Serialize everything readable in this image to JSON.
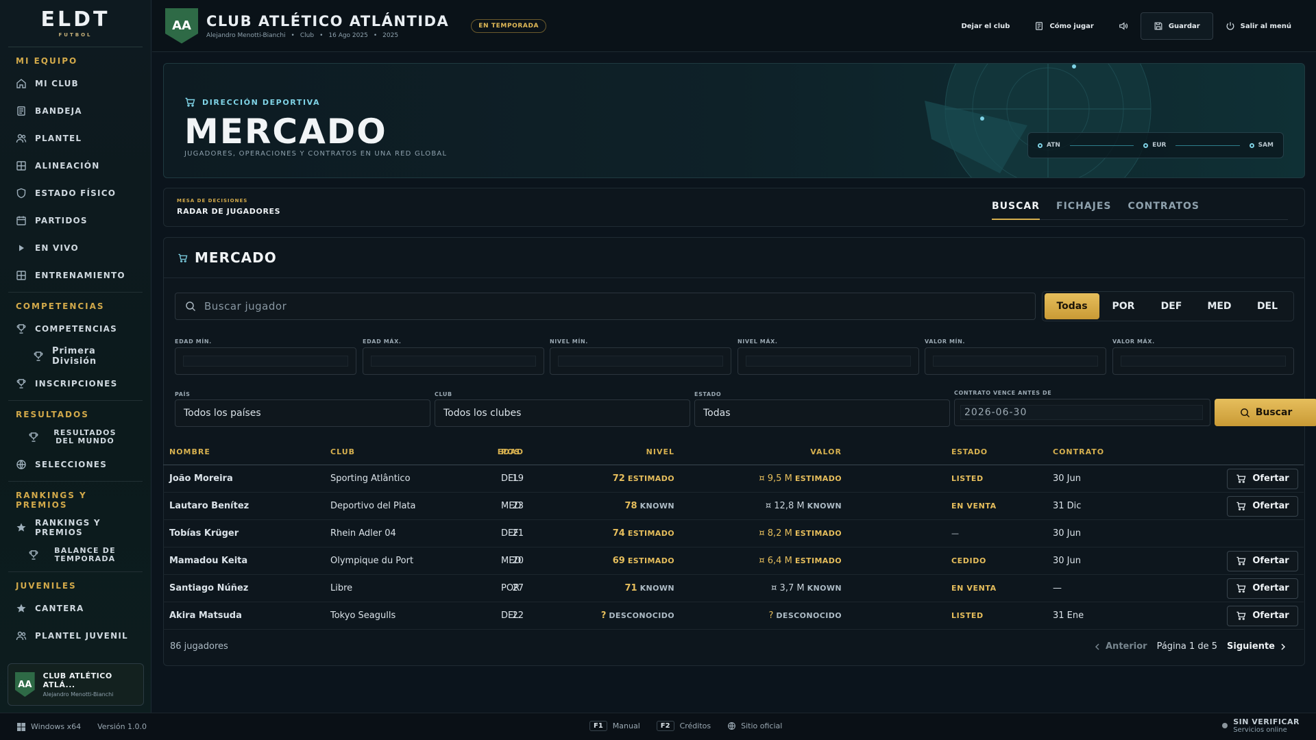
{
  "app": {
    "logo": "ELDT",
    "logo_sub": "FUTBOL"
  },
  "sidebar": {
    "sections": [
      {
        "title": "MI EQUIPO",
        "items": [
          {
            "label": "MI CLUB",
            "icon": "home-icon"
          },
          {
            "label": "BANDEJA",
            "icon": "inbox-icon"
          },
          {
            "label": "PLANTEL",
            "icon": "users-icon"
          },
          {
            "label": "ALINEACIÓN",
            "icon": "formation-icon"
          },
          {
            "label": "ESTADO FÍSICO",
            "icon": "shield-icon"
          },
          {
            "label": "PARTIDOS",
            "icon": "calendar-icon"
          },
          {
            "label": "EN VIVO",
            "icon": "play-icon"
          },
          {
            "label": "ENTRENAMIENTO",
            "icon": "training-icon"
          }
        ]
      },
      {
        "title": "COMPETENCIAS",
        "items": [
          {
            "label": "COMPETENCIAS",
            "icon": "trophy-icon"
          },
          {
            "label": "Primera División",
            "icon": "trophy-icon"
          },
          {
            "label": "INSCRIPCIONES",
            "icon": "trophy-icon"
          }
        ]
      },
      {
        "title": "RESULTADOS",
        "items": [
          {
            "label": "RESULTADOS DEL MUNDO",
            "icon": "trophy-icon"
          },
          {
            "label": "SELECCIONES",
            "icon": "globe-icon"
          }
        ]
      },
      {
        "title": "RANKINGS Y PREMIOS",
        "items": [
          {
            "label": "RANKINGS Y PREMIOS",
            "icon": "star-icon"
          },
          {
            "label": "BALANCE DE TEMPORADA",
            "icon": "trophy-icon"
          }
        ]
      },
      {
        "title": "JUVENILES",
        "items": [
          {
            "label": "CANTERA",
            "icon": "star-icon"
          },
          {
            "label": "PLANTEL JUVENIL",
            "icon": "users-icon"
          }
        ]
      }
    ],
    "club_card": {
      "badge": "AA",
      "name": "CLUB ATLÉTICO ATLÁ...",
      "manager": "Alejandro Menotti-Bianchi"
    }
  },
  "topbar": {
    "badge": "AA",
    "club_name": "CLUB ATLÉTICO ATLÁNTIDA",
    "meta": [
      "Alejandro Menotti-Bianchi",
      "•",
      "Club",
      "•",
      "16 Ago 2025",
      "•",
      "2025"
    ],
    "season_status": "EN TEMPORADA",
    "actions": {
      "leave": "Dejar el club",
      "how_to": "Cómo jugar",
      "save": "Guardar",
      "exit": "Salir al menú"
    }
  },
  "hero": {
    "kicker": "DIRECCIÓN DEPORTIVA",
    "title": "MERCADO",
    "subtitle": "JUGADORES, OPERACIONES Y CONTRATOS EN UNA RED GLOBAL",
    "route": [
      "ATN",
      "EUR",
      "SAM"
    ]
  },
  "subnav": {
    "kicker": "MESA DE DECISIONES",
    "title": "RADAR DE JUGADORES",
    "tabs": [
      "BUSCAR",
      "FICHAJES",
      "CONTRATOS"
    ],
    "active_tab": "BUSCAR"
  },
  "market": {
    "title": "MERCADO",
    "search_placeholder": "Buscar jugador",
    "positions": [
      "Todas",
      "POR",
      "DEF",
      "MED",
      "DEL"
    ],
    "active_position": "Todas",
    "range_filters": [
      {
        "label": "EDAD MÍN.",
        "value": ""
      },
      {
        "label": "EDAD MÁX.",
        "value": ""
      },
      {
        "label": "NIVEL MÍN.",
        "value": ""
      },
      {
        "label": "NIVEL MÁX.",
        "value": ""
      },
      {
        "label": "VALOR MÍN.",
        "value": ""
      },
      {
        "label": "VALOR MÁX.",
        "value": ""
      }
    ],
    "country": {
      "label": "PAÍS",
      "value": "Todos los países"
    },
    "club": {
      "label": "CLUB",
      "value": "Todos los clubes"
    },
    "status": {
      "label": "ESTADO",
      "value": "Todas"
    },
    "contract": {
      "label": "CONTRATO VENCE ANTES DE",
      "value": "2026-06-30"
    },
    "search_button": "Buscar",
    "columns": [
      "NOMBRE",
      "CLUB",
      "POS",
      "EDAD",
      "NIVEL",
      "VALOR",
      "ESTADO",
      "CONTRATO"
    ],
    "rows": [
      {
        "name": "João Moreira",
        "club": "Sporting Atlântico",
        "pos": "DEL",
        "age": "19",
        "level": "72",
        "level_q": "ESTIMADO",
        "value": "¤ 9,5 M",
        "value_q": "ESTIMADO",
        "state": "LISTED",
        "contract": "30 Jun",
        "offer": "Ofertar"
      },
      {
        "name": "Lautaro Benítez",
        "club": "Deportivo del Plata",
        "pos": "MED",
        "age": "23",
        "level": "78",
        "level_q": "KNOWN",
        "value": "¤ 12,8 M",
        "value_q": "KNOWN",
        "state": "EN VENTA",
        "contract": "31 Dic",
        "offer": "Ofertar"
      },
      {
        "name": "Tobías Krüger",
        "club": "Rhein Adler 04",
        "pos": "DEF",
        "age": "21",
        "level": "74",
        "level_q": "ESTIMADO",
        "value": "¤ 8,2 M",
        "value_q": "ESTIMADO",
        "state": "—",
        "contract": "30 Jun",
        "offer": ""
      },
      {
        "name": "Mamadou Keita",
        "club": "Olympique du Port",
        "pos": "MED",
        "age": "20",
        "level": "69",
        "level_q": "ESTIMADO",
        "value": "¤ 6,4 M",
        "value_q": "ESTIMADO",
        "state": "CEDIDO",
        "contract": "30 Jun",
        "offer": "Ofertar"
      },
      {
        "name": "Santiago Núñez",
        "club": "Libre",
        "pos": "POR",
        "age": "27",
        "level": "71",
        "level_q": "KNOWN",
        "value": "¤ 3,7 M",
        "value_q": "KNOWN",
        "state": "EN VENTA",
        "contract": "—",
        "offer": "Ofertar"
      },
      {
        "name": "Akira Matsuda",
        "club": "Tokyo Seagulls",
        "pos": "DEL",
        "age": "22",
        "level": "?",
        "level_q": "DESCONOCIDO",
        "value": "?",
        "value_q": "DESCONOCIDO",
        "state": "LISTED",
        "contract": "31 Ene",
        "offer": "Ofertar"
      }
    ],
    "count": "86 jugadores",
    "pager": {
      "prev": "Anterior",
      "page": "Página 1 de 5",
      "next": "Siguiente"
    }
  },
  "statusbar": {
    "os": "Windows x64",
    "version": "Versión 1.0.0",
    "f1_key": "F1",
    "f1_label": "Manual",
    "f2_key": "F2",
    "f2_label": "Créditos",
    "site": "Sitio oficial",
    "verify": "SIN VERIFICAR",
    "online": "Servicios online"
  },
  "colors": {
    "accent": "#d6b04f",
    "cyan": "#7fd3e6",
    "badge_green": "#2e6a46",
    "background": "#0b141c"
  }
}
